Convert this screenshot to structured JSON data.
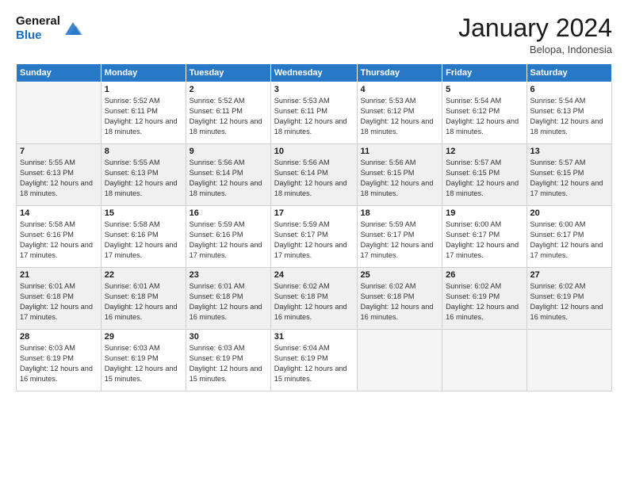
{
  "header": {
    "logo_general": "General",
    "logo_blue": "Blue",
    "month_year": "January 2024",
    "location": "Belopa, Indonesia"
  },
  "days_of_week": [
    "Sunday",
    "Monday",
    "Tuesday",
    "Wednesday",
    "Thursday",
    "Friday",
    "Saturday"
  ],
  "weeks": [
    [
      {
        "day": "",
        "sunrise": "",
        "sunset": "",
        "daylight": ""
      },
      {
        "day": "1",
        "sunrise": "Sunrise: 5:52 AM",
        "sunset": "Sunset: 6:11 PM",
        "daylight": "Daylight: 12 hours and 18 minutes."
      },
      {
        "day": "2",
        "sunrise": "Sunrise: 5:52 AM",
        "sunset": "Sunset: 6:11 PM",
        "daylight": "Daylight: 12 hours and 18 minutes."
      },
      {
        "day": "3",
        "sunrise": "Sunrise: 5:53 AM",
        "sunset": "Sunset: 6:11 PM",
        "daylight": "Daylight: 12 hours and 18 minutes."
      },
      {
        "day": "4",
        "sunrise": "Sunrise: 5:53 AM",
        "sunset": "Sunset: 6:12 PM",
        "daylight": "Daylight: 12 hours and 18 minutes."
      },
      {
        "day": "5",
        "sunrise": "Sunrise: 5:54 AM",
        "sunset": "Sunset: 6:12 PM",
        "daylight": "Daylight: 12 hours and 18 minutes."
      },
      {
        "day": "6",
        "sunrise": "Sunrise: 5:54 AM",
        "sunset": "Sunset: 6:13 PM",
        "daylight": "Daylight: 12 hours and 18 minutes."
      }
    ],
    [
      {
        "day": "7",
        "sunrise": "Sunrise: 5:55 AM",
        "sunset": "Sunset: 6:13 PM",
        "daylight": "Daylight: 12 hours and 18 minutes."
      },
      {
        "day": "8",
        "sunrise": "Sunrise: 5:55 AM",
        "sunset": "Sunset: 6:13 PM",
        "daylight": "Daylight: 12 hours and 18 minutes."
      },
      {
        "day": "9",
        "sunrise": "Sunrise: 5:56 AM",
        "sunset": "Sunset: 6:14 PM",
        "daylight": "Daylight: 12 hours and 18 minutes."
      },
      {
        "day": "10",
        "sunrise": "Sunrise: 5:56 AM",
        "sunset": "Sunset: 6:14 PM",
        "daylight": "Daylight: 12 hours and 18 minutes."
      },
      {
        "day": "11",
        "sunrise": "Sunrise: 5:56 AM",
        "sunset": "Sunset: 6:15 PM",
        "daylight": "Daylight: 12 hours and 18 minutes."
      },
      {
        "day": "12",
        "sunrise": "Sunrise: 5:57 AM",
        "sunset": "Sunset: 6:15 PM",
        "daylight": "Daylight: 12 hours and 18 minutes."
      },
      {
        "day": "13",
        "sunrise": "Sunrise: 5:57 AM",
        "sunset": "Sunset: 6:15 PM",
        "daylight": "Daylight: 12 hours and 17 minutes."
      }
    ],
    [
      {
        "day": "14",
        "sunrise": "Sunrise: 5:58 AM",
        "sunset": "Sunset: 6:16 PM",
        "daylight": "Daylight: 12 hours and 17 minutes."
      },
      {
        "day": "15",
        "sunrise": "Sunrise: 5:58 AM",
        "sunset": "Sunset: 6:16 PM",
        "daylight": "Daylight: 12 hours and 17 minutes."
      },
      {
        "day": "16",
        "sunrise": "Sunrise: 5:59 AM",
        "sunset": "Sunset: 6:16 PM",
        "daylight": "Daylight: 12 hours and 17 minutes."
      },
      {
        "day": "17",
        "sunrise": "Sunrise: 5:59 AM",
        "sunset": "Sunset: 6:17 PM",
        "daylight": "Daylight: 12 hours and 17 minutes."
      },
      {
        "day": "18",
        "sunrise": "Sunrise: 5:59 AM",
        "sunset": "Sunset: 6:17 PM",
        "daylight": "Daylight: 12 hours and 17 minutes."
      },
      {
        "day": "19",
        "sunrise": "Sunrise: 6:00 AM",
        "sunset": "Sunset: 6:17 PM",
        "daylight": "Daylight: 12 hours and 17 minutes."
      },
      {
        "day": "20",
        "sunrise": "Sunrise: 6:00 AM",
        "sunset": "Sunset: 6:17 PM",
        "daylight": "Daylight: 12 hours and 17 minutes."
      }
    ],
    [
      {
        "day": "21",
        "sunrise": "Sunrise: 6:01 AM",
        "sunset": "Sunset: 6:18 PM",
        "daylight": "Daylight: 12 hours and 17 minutes."
      },
      {
        "day": "22",
        "sunrise": "Sunrise: 6:01 AM",
        "sunset": "Sunset: 6:18 PM",
        "daylight": "Daylight: 12 hours and 16 minutes."
      },
      {
        "day": "23",
        "sunrise": "Sunrise: 6:01 AM",
        "sunset": "Sunset: 6:18 PM",
        "daylight": "Daylight: 12 hours and 16 minutes."
      },
      {
        "day": "24",
        "sunrise": "Sunrise: 6:02 AM",
        "sunset": "Sunset: 6:18 PM",
        "daylight": "Daylight: 12 hours and 16 minutes."
      },
      {
        "day": "25",
        "sunrise": "Sunrise: 6:02 AM",
        "sunset": "Sunset: 6:18 PM",
        "daylight": "Daylight: 12 hours and 16 minutes."
      },
      {
        "day": "26",
        "sunrise": "Sunrise: 6:02 AM",
        "sunset": "Sunset: 6:19 PM",
        "daylight": "Daylight: 12 hours and 16 minutes."
      },
      {
        "day": "27",
        "sunrise": "Sunrise: 6:02 AM",
        "sunset": "Sunset: 6:19 PM",
        "daylight": "Daylight: 12 hours and 16 minutes."
      }
    ],
    [
      {
        "day": "28",
        "sunrise": "Sunrise: 6:03 AM",
        "sunset": "Sunset: 6:19 PM",
        "daylight": "Daylight: 12 hours and 16 minutes."
      },
      {
        "day": "29",
        "sunrise": "Sunrise: 6:03 AM",
        "sunset": "Sunset: 6:19 PM",
        "daylight": "Daylight: 12 hours and 15 minutes."
      },
      {
        "day": "30",
        "sunrise": "Sunrise: 6:03 AM",
        "sunset": "Sunset: 6:19 PM",
        "daylight": "Daylight: 12 hours and 15 minutes."
      },
      {
        "day": "31",
        "sunrise": "Sunrise: 6:04 AM",
        "sunset": "Sunset: 6:19 PM",
        "daylight": "Daylight: 12 hours and 15 minutes."
      },
      {
        "day": "",
        "sunrise": "",
        "sunset": "",
        "daylight": ""
      },
      {
        "day": "",
        "sunrise": "",
        "sunset": "",
        "daylight": ""
      },
      {
        "day": "",
        "sunrise": "",
        "sunset": "",
        "daylight": ""
      }
    ]
  ]
}
